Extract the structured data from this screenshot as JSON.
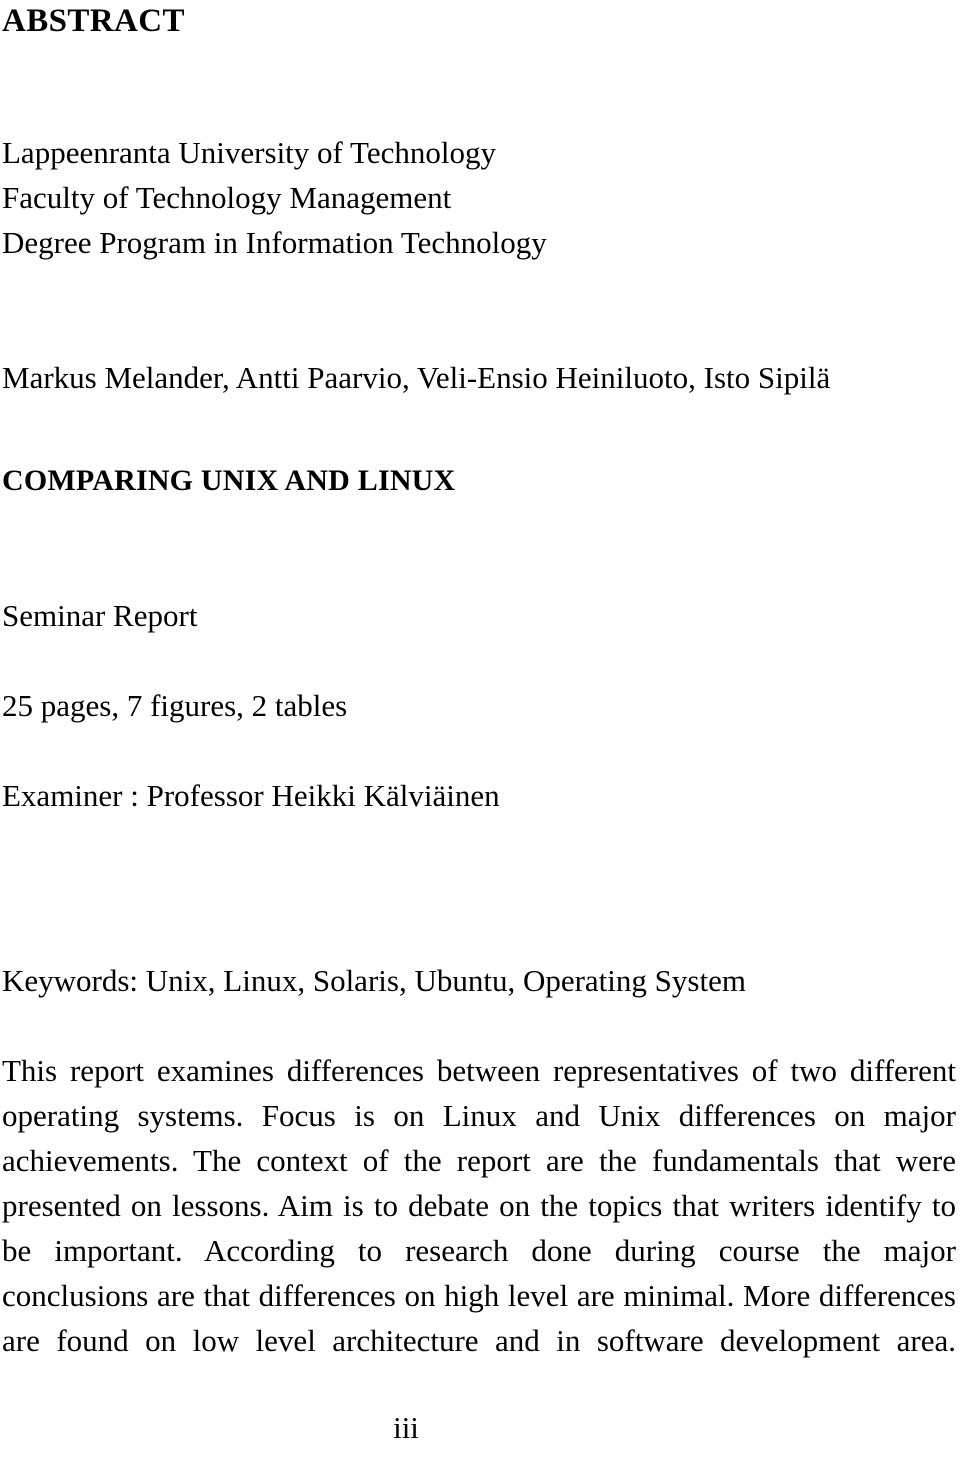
{
  "document": {
    "section_heading": "ABSTRACT",
    "institution": {
      "university": "Lappeenranta University of Technology",
      "faculty": "Faculty of Technology Management",
      "program": "Degree Program in Information Technology"
    },
    "authors": "Markus Melander, Antti Paarvio, Veli-Ensio Heiniluoto, Isto Sipilä",
    "title": "COMPARING UNIX AND LINUX",
    "report_type": "Seminar Report",
    "extent": "25 pages, 7 figures, 2 tables",
    "examiner": "Examiner : Professor Heikki Kälviäinen",
    "keywords": "Keywords: Unix, Linux, Solaris, Ubuntu, Operating System",
    "abstract_text": "This report examines differences between representatives of two different operating systems. Focus is on Linux and Unix differences on major achievements. The context of the report are the fundamentals that were presented on lessons. Aim is to debate on the topics that writers identify to be important. According to research done during course the major conclusions are that differences on high level are minimal. More differences are found on low level architecture and in software development area.",
    "page_number": "iii"
  }
}
